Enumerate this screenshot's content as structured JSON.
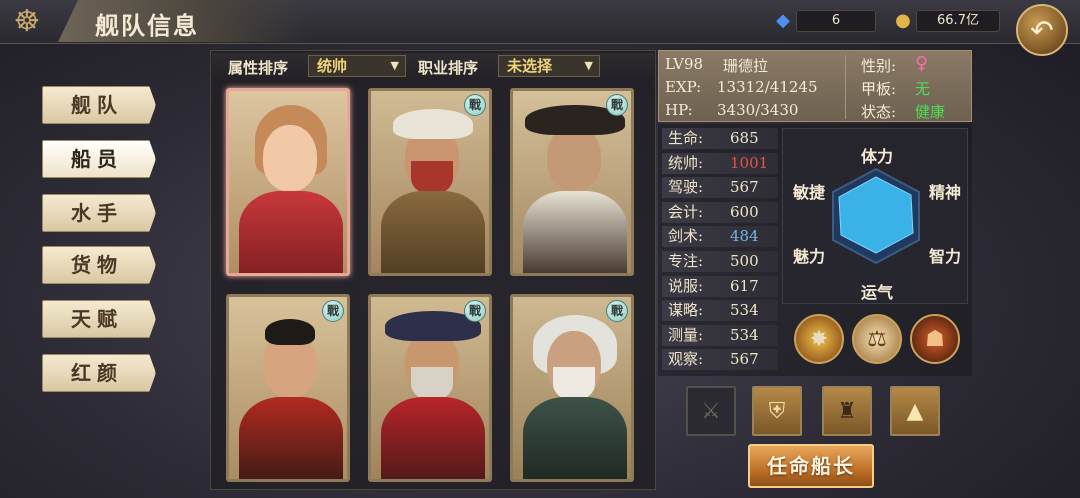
{
  "header": {
    "title": "舰队信息",
    "gems": "6",
    "gold": "66.7亿"
  },
  "nav": {
    "items": [
      {
        "label": "舰队"
      },
      {
        "label": "船员"
      },
      {
        "label": "水手"
      },
      {
        "label": "货物"
      },
      {
        "label": "天赋"
      },
      {
        "label": "红颜"
      }
    ],
    "active_index": 1
  },
  "filters": {
    "attr_sort_label": "属性排序",
    "attr_sort_value": "统帅",
    "job_sort_label": "职业排序",
    "job_sort_value": "未选择"
  },
  "crew_cards": [
    {
      "name": "crew-1",
      "badge": "",
      "selected": true
    },
    {
      "name": "crew-2",
      "badge": "戰"
    },
    {
      "name": "crew-3",
      "badge": "戰"
    },
    {
      "name": "crew-4",
      "badge": "戰"
    },
    {
      "name": "crew-5",
      "badge": "戰"
    },
    {
      "name": "crew-6",
      "badge": "戰"
    }
  ],
  "info": {
    "level": "LV98",
    "name": "珊德拉",
    "exp_label": "EXP:",
    "exp_value": "13312/41245",
    "hp_label": "HP:",
    "hp_value": "3430/3430",
    "gender_label": "性别:",
    "gender_value": "♀",
    "deck_label": "甲板:",
    "deck_value": "无",
    "status_label": "状态:",
    "status_value": "健康"
  },
  "stats": [
    {
      "label": "生命:",
      "value": "685",
      "color": "#efe4ca"
    },
    {
      "label": "统帅:",
      "value": "1001",
      "color": "#e8504a"
    },
    {
      "label": "驾驶:",
      "value": "567",
      "color": "#efe4ca"
    },
    {
      "label": "会计:",
      "value": "600",
      "color": "#efe4ca"
    },
    {
      "label": "剑术:",
      "value": "484",
      "color": "#6fb4ea"
    },
    {
      "label": "专注:",
      "value": "500",
      "color": "#efe4ca"
    },
    {
      "label": "说服:",
      "value": "617",
      "color": "#efe4ca"
    },
    {
      "label": "谋略:",
      "value": "534",
      "color": "#efe4ca"
    },
    {
      "label": "测量:",
      "value": "534",
      "color": "#efe4ca"
    },
    {
      "label": "观察:",
      "value": "567",
      "color": "#efe4ca"
    }
  ],
  "radar": {
    "labels": [
      "体力",
      "精神",
      "智力",
      "运气",
      "魅力",
      "敏捷"
    ]
  },
  "appoint_label": "任命船长"
}
